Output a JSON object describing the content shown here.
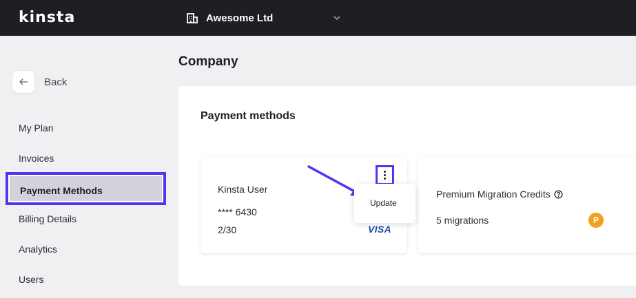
{
  "topbar": {
    "logo": "kinsta",
    "company": "Awesome Ltd"
  },
  "sidebar": {
    "back_label": "Back",
    "items": [
      {
        "label": "My Plan"
      },
      {
        "label": "Invoices"
      },
      {
        "label": "Payment Methods",
        "active": true
      },
      {
        "label": "Billing Details"
      },
      {
        "label": "Analytics"
      },
      {
        "label": "Users"
      }
    ]
  },
  "main": {
    "page_title": "Company",
    "section_title": "Payment methods",
    "card": {
      "holder": "Kinsta User",
      "number": "**** 6430",
      "expiry": "2/30",
      "brand": "VISA",
      "menu_item": "Update"
    },
    "migrations": {
      "title": "Premium Migration Credits",
      "count": "5 migrations",
      "badge": "P"
    }
  },
  "colors": {
    "topbar": "#1f1f23",
    "highlight": "#5333ed",
    "badge": "#f59f1e",
    "visa": "#1a4ba3",
    "active_nav": "#d2d3da"
  }
}
